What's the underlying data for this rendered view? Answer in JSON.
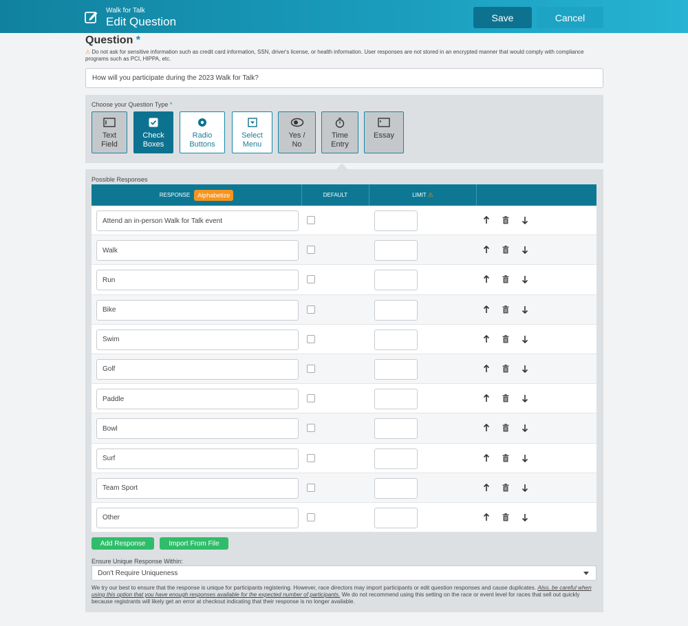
{
  "header": {
    "app_name": "Walk for Talk",
    "title": "Edit Question",
    "save_label": "Save",
    "cancel_label": "Cancel"
  },
  "question": {
    "heading": "Question",
    "required_mark": "*",
    "warning_icon": "warning-triangle-icon",
    "warning": "Do not ask for sensitive information such as credit card information, SSN, driver's license, or health information. User responses are not stored in an encrypted manner that would comply with compliance programs such as PCI, HIPPA, etc.",
    "value": "How will you participate during the 2023 Walk for Talk?"
  },
  "question_type": {
    "label": "Choose your Question Type",
    "required_mark": "*",
    "selected": "Check Boxes",
    "types": [
      {
        "line1": "Text",
        "line2": "Field",
        "icon": "text-field-icon",
        "style": "grey"
      },
      {
        "line1": "Check",
        "line2": "Boxes",
        "icon": "checkbox-icon",
        "style": "active"
      },
      {
        "line1": "Radio",
        "line2": "Buttons",
        "icon": "radio-icon",
        "style": "white"
      },
      {
        "line1": "Select",
        "line2": "Menu",
        "icon": "select-menu-icon",
        "style": "white"
      },
      {
        "line1": "Yes /",
        "line2": "No",
        "icon": "yes-no-toggle-icon",
        "style": "grey"
      },
      {
        "line1": "Time",
        "line2": "Entry",
        "icon": "stopwatch-icon",
        "style": "grey"
      },
      {
        "line1": "Essay",
        "line2": "",
        "icon": "essay-icon",
        "style": "grey"
      }
    ]
  },
  "responses": {
    "label": "Possible Responses",
    "columns": {
      "response": "RESPONSE",
      "alphabetize": "Alphabetize",
      "default": "DEFAULT",
      "limit": "LIMIT"
    },
    "rows": [
      {
        "value": "Attend an in-person Walk for Talk event",
        "default": false,
        "limit": ""
      },
      {
        "value": "Walk",
        "default": false,
        "limit": ""
      },
      {
        "value": "Run",
        "default": false,
        "limit": ""
      },
      {
        "value": "Bike",
        "default": false,
        "limit": ""
      },
      {
        "value": "Swim",
        "default": false,
        "limit": ""
      },
      {
        "value": "Golf",
        "default": false,
        "limit": ""
      },
      {
        "value": "Paddle",
        "default": false,
        "limit": ""
      },
      {
        "value": "Bowl",
        "default": false,
        "limit": ""
      },
      {
        "value": "Surf",
        "default": false,
        "limit": ""
      },
      {
        "value": "Team Sport",
        "default": false,
        "limit": ""
      },
      {
        "value": "Other",
        "default": false,
        "limit": ""
      }
    ],
    "row_actions": [
      "arrow-up-icon",
      "trash-icon",
      "arrow-down-icon"
    ],
    "add_label": "Add Response",
    "import_label": "Import From File"
  },
  "uniqueness": {
    "label": "Ensure Unique Response Within:",
    "selected": "Don't Require Uniqueness",
    "help_1": "We try our best to ensure that the response is unique for participants registering. However, race directors may import participants or edit question responses and cause duplicates.",
    "help_2": "Also, be careful when using this option that you have enough responses available for the expected number of participants.",
    "help_3": "We do not recommend using this setting on the race or event level for races that sell out quickly because registrants will likely get an error at checkout indicating that their response is no longer available."
  },
  "colors": {
    "header_start": "#10829f",
    "header_end": "#27b3d3",
    "accent": "#0e7894",
    "alphabetize": "#f7941d",
    "green": "#2fbd6a"
  }
}
